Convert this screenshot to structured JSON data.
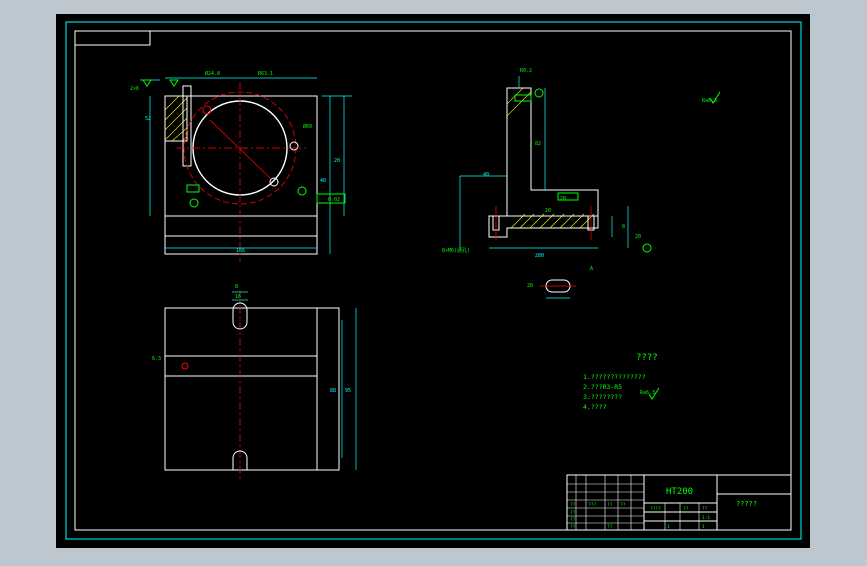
{
  "colors": {
    "background": "#bcc7cf",
    "paper": "#000000",
    "frame": "#00ffff",
    "outline": "#ffffff",
    "dimension": "#00ffff",
    "centerline": "#ff0000",
    "annotation": "#00ff00",
    "hatch": "#ffff00"
  },
  "drawing": {
    "view1_dims": {
      "top_left": "Ø24.8",
      "top_right": "R63.1",
      "side_tol": "Ø60",
      "bottom": "166",
      "vertical_1": "20",
      "vertical_2": "40",
      "vertical_3": "52",
      "side_label": "2×6",
      "tol_note": "0.02"
    },
    "view2_dims": {
      "top_slot": "8",
      "top_slot2": "16",
      "vertical": "95",
      "vertical2": "88",
      "hole": "6.3"
    },
    "view3_dims": {
      "top_label": "R0.2",
      "height1": "82",
      "height2": "40",
      "base": "20",
      "base2": "20",
      "tol": "8",
      "bottom_note": "8×M6(通孔)",
      "sect_label": "A",
      "width": "280",
      "right_note": "20"
    },
    "roughness_top": "Ra6.3",
    "roughness_note": "Ra6.3",
    "slot_dim": "20"
  },
  "notes": {
    "title": "????",
    "lines": [
      "1.??????????????",
      "2.???R3-R5",
      "3.????????",
      "4.????"
    ]
  },
  "title_block": {
    "material": "HT200",
    "drawing_name": "?????",
    "cells": [
      "??",
      "???",
      "??",
      "??",
      "??",
      "??",
      "??",
      "??",
      "????",
      "??",
      "??",
      "1:1",
      "1",
      "1"
    ]
  }
}
